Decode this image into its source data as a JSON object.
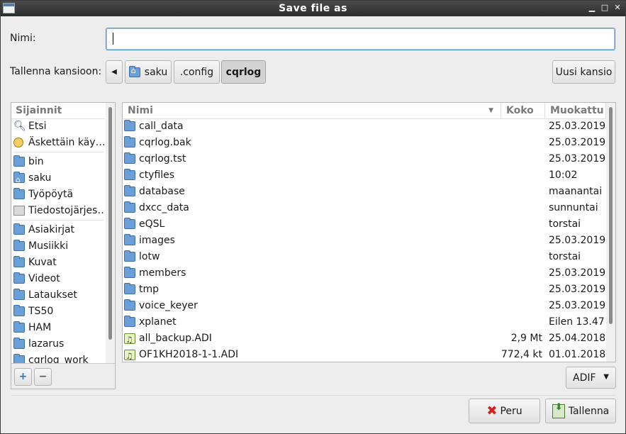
{
  "window": {
    "title": "Save file as"
  },
  "titlebar_buttons": {
    "minimize": "▁",
    "maximize": "□",
    "close": "✕"
  },
  "name_field": {
    "label": "Nimi:",
    "value": ""
  },
  "folder_bar": {
    "label": "Tallenna kansioon:",
    "back": "◀",
    "crumbs": [
      "saku",
      ".config",
      "cqrlog"
    ],
    "new_folder": "Uusi kansio"
  },
  "places": {
    "header": "Sijainnit",
    "items": [
      {
        "label": "Etsi",
        "icon": "search-icon"
      },
      {
        "label": "Äskettäin käy…",
        "icon": "recent-icon"
      },
      {
        "label": "bin",
        "icon": "folder-icon"
      },
      {
        "label": "saku",
        "icon": "home-folder-icon"
      },
      {
        "label": "Työpöytä",
        "icon": "desktop-folder-icon"
      },
      {
        "label": "Tiedostojärjes…",
        "icon": "filesystem-icon"
      },
      {
        "label": "Asiakirjat",
        "icon": "documents-folder-icon"
      },
      {
        "label": "Musiikki",
        "icon": "music-folder-icon"
      },
      {
        "label": "Kuvat",
        "icon": "pictures-folder-icon"
      },
      {
        "label": "Videot",
        "icon": "videos-folder-icon"
      },
      {
        "label": "Lataukset",
        "icon": "downloads-folder-icon"
      },
      {
        "label": "TS50",
        "icon": "folder-icon"
      },
      {
        "label": "HAM",
        "icon": "folder-icon"
      },
      {
        "label": "lazarus",
        "icon": "folder-icon"
      },
      {
        "label": "cqrlog_work",
        "icon": "folder-icon"
      }
    ],
    "add": "+",
    "remove": "−"
  },
  "files": {
    "columns": [
      "Nimi",
      "Koko",
      "Muokattu"
    ],
    "rows": [
      {
        "name": "call_data",
        "size": "",
        "date": "25.03.2019",
        "type": "folder"
      },
      {
        "name": "cqrlog.bak",
        "size": "",
        "date": "25.03.2019",
        "type": "folder"
      },
      {
        "name": "cqrlog.tst",
        "size": "",
        "date": "25.03.2019",
        "type": "folder"
      },
      {
        "name": "ctyfiles",
        "size": "",
        "date": "10:02",
        "type": "folder"
      },
      {
        "name": "database",
        "size": "",
        "date": "maanantai",
        "type": "folder"
      },
      {
        "name": "dxcc_data",
        "size": "",
        "date": "sunnuntai",
        "type": "folder"
      },
      {
        "name": "eQSL",
        "size": "",
        "date": "torstai",
        "type": "folder"
      },
      {
        "name": "images",
        "size": "",
        "date": "25.03.2019",
        "type": "folder"
      },
      {
        "name": "lotw",
        "size": "",
        "date": "torstai",
        "type": "folder"
      },
      {
        "name": "members",
        "size": "",
        "date": "25.03.2019",
        "type": "folder"
      },
      {
        "name": "tmp",
        "size": "",
        "date": "25.03.2019",
        "type": "folder"
      },
      {
        "name": "voice_keyer",
        "size": "",
        "date": "25.03.2019",
        "type": "folder"
      },
      {
        "name": "xplanet",
        "size": "",
        "date": "Eilen 13.47",
        "type": "folder"
      },
      {
        "name": "all_backup.ADI",
        "size": "2,9 Mt",
        "date": "25.04.2018",
        "type": "audio"
      },
      {
        "name": "OF1KH2018-1-1.ADI",
        "size": "772,4 kt",
        "date": "01.01.2018",
        "type": "audio"
      }
    ]
  },
  "filter": {
    "value": "ADIF"
  },
  "actions": {
    "cancel": "Peru",
    "save": "Tallenna"
  }
}
